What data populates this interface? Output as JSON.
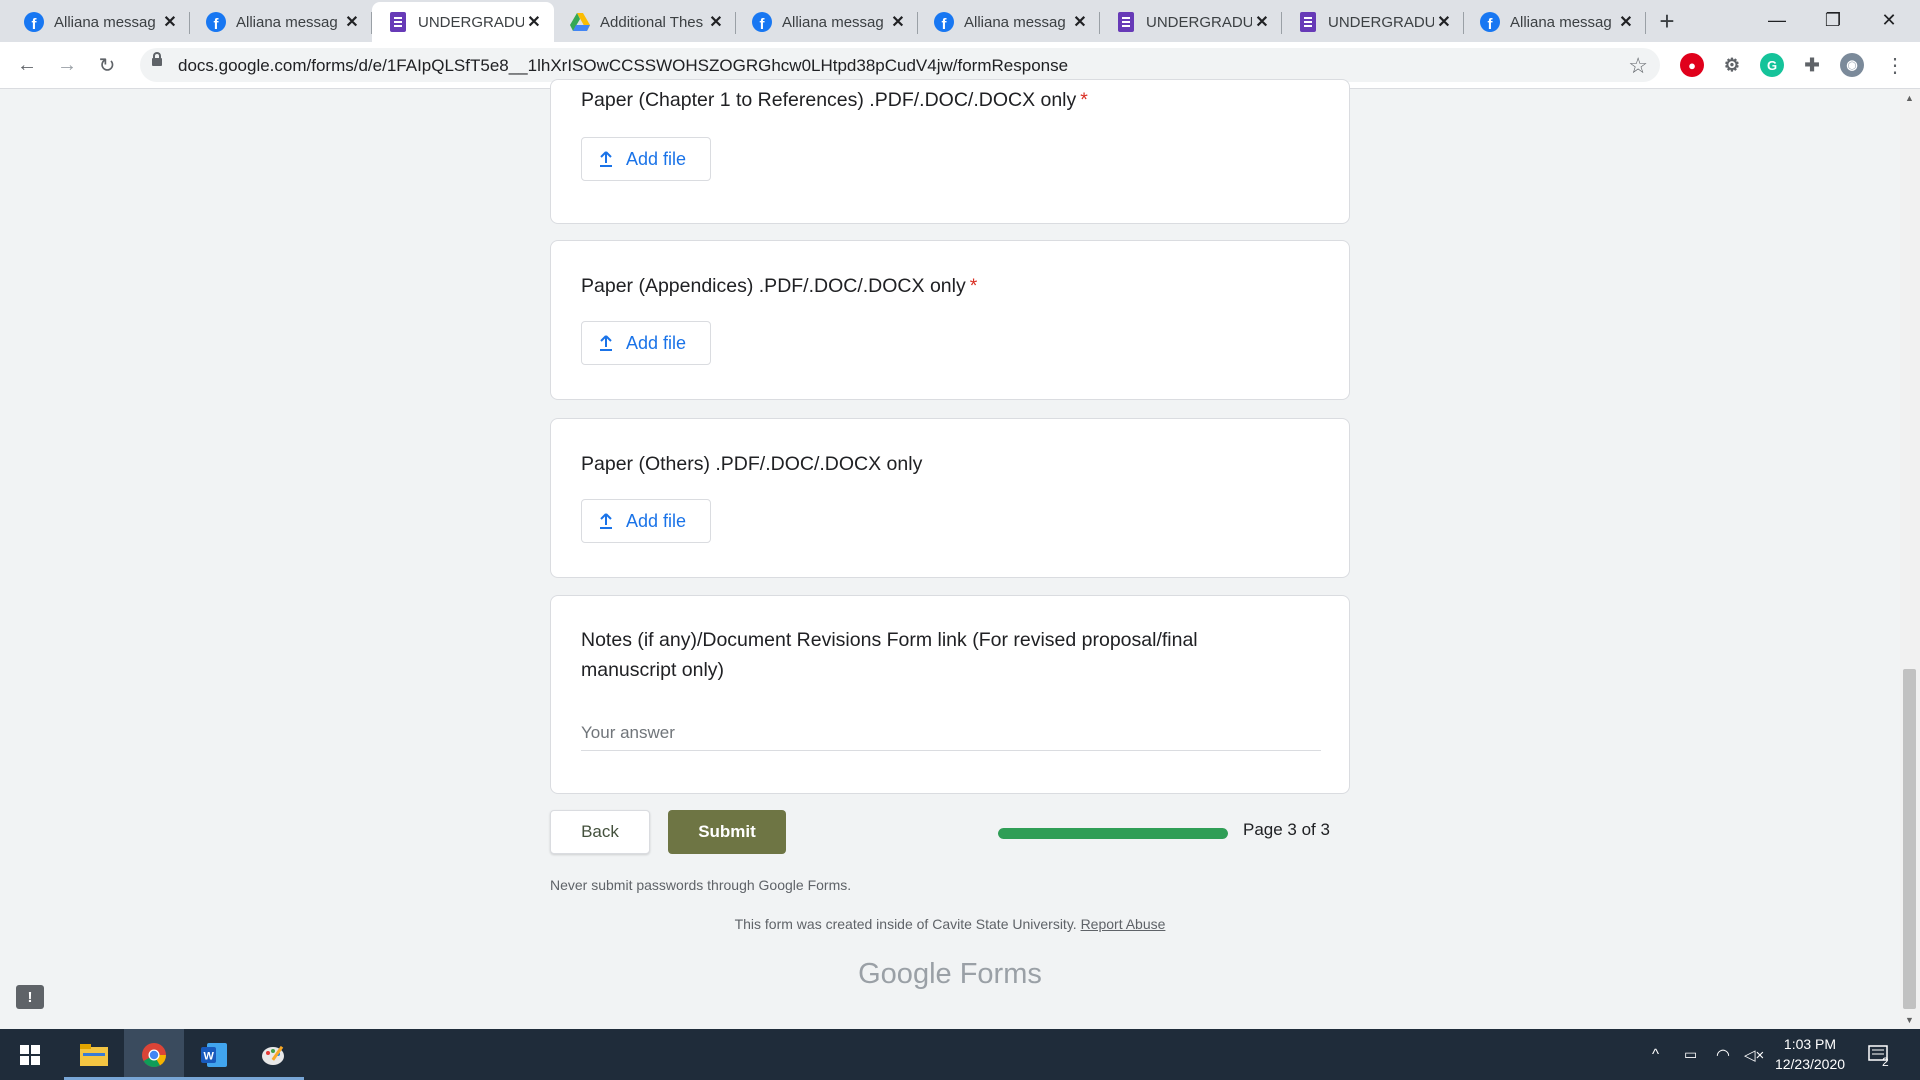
{
  "browser": {
    "tabs": [
      {
        "title": "Alliana messag",
        "icon": "facebook-icon",
        "active": false
      },
      {
        "title": "Alliana messag",
        "icon": "facebook-icon",
        "active": false
      },
      {
        "title": "UNDERGRADU",
        "icon": "google-forms-icon",
        "active": true
      },
      {
        "title": "Additional Thes",
        "icon": "google-drive-icon",
        "active": false
      },
      {
        "title": "Alliana messag",
        "icon": "facebook-icon",
        "active": false
      },
      {
        "title": "Alliana messag",
        "icon": "facebook-icon",
        "active": false
      },
      {
        "title": "UNDERGRADU",
        "icon": "google-forms-icon",
        "active": false
      },
      {
        "title": "UNDERGRADU",
        "icon": "google-forms-icon",
        "active": false
      },
      {
        "title": "Alliana messag",
        "icon": "facebook-icon",
        "active": false
      }
    ],
    "url": "docs.google.com/forms/d/e/1FAIpQLSfT5e8__1lhXrISOwCCSSWOHSZOGRGhcw0LHtpd38pCudV4jw/formResponse"
  },
  "form": {
    "questions": [
      {
        "title": "Paper (Chapter 1 to References) .PDF/.DOC/.DOCX only",
        "required_mark": "*",
        "button": "Add file"
      },
      {
        "title": "Paper (Appendices) .PDF/.DOC/.DOCX only",
        "required_mark": "*",
        "button": "Add file"
      },
      {
        "title": "Paper (Others) .PDF/.DOC/.DOCX only",
        "required_mark": "",
        "button": "Add file"
      }
    ],
    "notes": {
      "title_line1": "Notes (if any)/Document Revisions Form link (For revised proposal/final",
      "title_line2": "manuscript only)",
      "placeholder": "Your answer"
    },
    "back_label": "Back",
    "submit_label": "Submit",
    "progress_fraction": 1.0,
    "page_indicator": "Page 3 of 3",
    "password_warning": "Never submit passwords through Google Forms.",
    "footer_text": "This form was created inside of Cavite State University.",
    "report_abuse": "Report Abuse",
    "brand_google": "Google",
    "brand_forms": "Forms"
  },
  "colors": {
    "submit_button": "#6e7544",
    "progress_fill": "#2f9e56",
    "link_blue": "#1a73e8",
    "required_red": "#d93025"
  },
  "taskbar": {
    "time": "1:03 PM",
    "date": "12/23/2020",
    "notification_count": "2"
  }
}
